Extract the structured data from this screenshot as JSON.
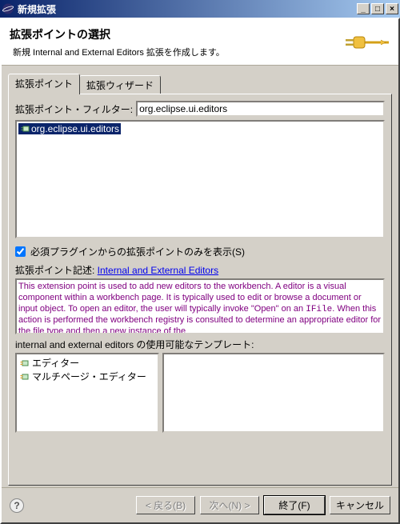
{
  "window": {
    "title": "新規拡張"
  },
  "banner": {
    "title": "拡張ポイントの選択",
    "desc": "新規 Internal and External Editors 拡張を作成します。"
  },
  "tabs": {
    "extpoints": "拡張ポイント",
    "wizard": "拡張ウィザード"
  },
  "filter": {
    "label": "拡張ポイント・フィルター:",
    "value": "org.eclipse.ui.editors"
  },
  "tree": {
    "item0": "org.eclipse.ui.editors"
  },
  "required_check": {
    "label": "必須プラグインからの拡張ポイントのみを表示(S)",
    "checked": true
  },
  "desc": {
    "label_prefix": "拡張ポイント記述: ",
    "link": "Internal and External Editors",
    "body_part1": "This extension point is used to add new editors to the workbench. A editor is a visual component within a workbench page. It is typically used to edit or browse a document or input object. To open an editor, the user will typically invoke \"Open\" on an ",
    "body_mono": "IFile",
    "body_part2": ". When this action is performed the workbench registry is consulted to determine an appropriate editor for the file type and then a new instance of the"
  },
  "templates": {
    "label": "internal and external editors の使用可能なテンプレート:",
    "item0": "エディター",
    "item1": "マルチページ・エディター"
  },
  "buttons": {
    "back": "< 戻る(B)",
    "next": "次へ(N) >",
    "finish": "終了(F)",
    "cancel": "キャンセル"
  }
}
